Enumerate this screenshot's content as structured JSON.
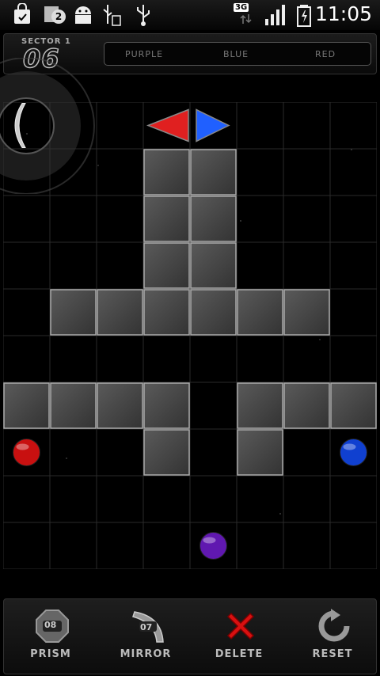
{
  "status_bar": {
    "notification_count": "2",
    "network": "3G",
    "time": "11:05",
    "icons": [
      "shopping-bag-icon",
      "download-icon",
      "android-icon",
      "usb-debug-icon",
      "usb-icon",
      "signal-icon",
      "battery-icon"
    ]
  },
  "hud": {
    "sector_label": "SECTOR 1",
    "sector_number": "06",
    "targets": [
      "PURPLE",
      "BLUE",
      "RED"
    ]
  },
  "board": {
    "grid_cols": 8,
    "grid_rows": 10,
    "blocks": [
      [
        3,
        1
      ],
      [
        4,
        1
      ],
      [
        3,
        2
      ],
      [
        4,
        2
      ],
      [
        3,
        3
      ],
      [
        4,
        3
      ],
      [
        1,
        4
      ],
      [
        2,
        4
      ],
      [
        3,
        4
      ],
      [
        4,
        4
      ],
      [
        5,
        4
      ],
      [
        6,
        4
      ],
      [
        0,
        6
      ],
      [
        1,
        6
      ],
      [
        2,
        6
      ],
      [
        3,
        6
      ],
      [
        5,
        6
      ],
      [
        6,
        6
      ],
      [
        7,
        6
      ],
      [
        3,
        7
      ],
      [
        5,
        7
      ]
    ],
    "orbs": [
      {
        "color": "red",
        "hex": "#c81010",
        "col": 0,
        "row": 7
      },
      {
        "color": "blue",
        "hex": "#1040d0",
        "col": 7,
        "row": 7
      },
      {
        "color": "purple",
        "hex": "#6018b0",
        "col": 4,
        "row": 9
      }
    ],
    "emitters": [
      {
        "color": "red",
        "hex": "#e02020",
        "direction": "left",
        "col": 3,
        "row": 0
      },
      {
        "color": "blue",
        "hex": "#2060ff",
        "direction": "right",
        "col": 4,
        "row": 0
      }
    ],
    "mirror": {
      "col": 0,
      "row": 0
    }
  },
  "toolbar": {
    "prism": {
      "label": "PRISM",
      "count": "08"
    },
    "mirror": {
      "label": "MIRROR",
      "count": "07"
    },
    "delete": {
      "label": "DELETE"
    },
    "reset": {
      "label": "RESET"
    }
  }
}
